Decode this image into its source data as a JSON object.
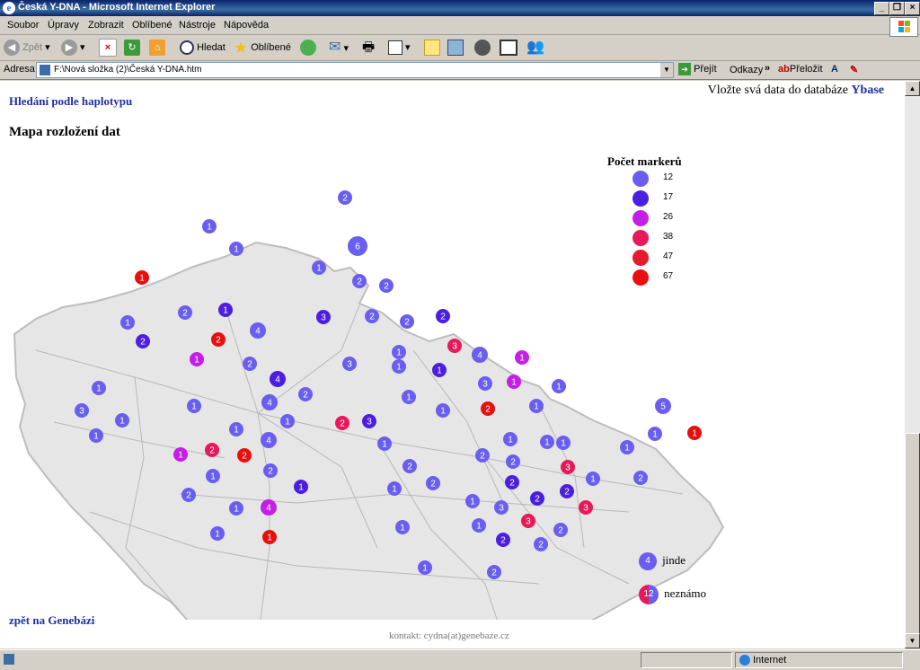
{
  "window": {
    "title": "Česká Y-DNA - Microsoft Internet Explorer"
  },
  "menu": [
    "Soubor",
    "Úpravy",
    "Zobrazit",
    "Oblíbené",
    "Nástroje",
    "Nápověda"
  ],
  "toolbar": {
    "back": "Zpět",
    "search": "Hledat",
    "favorites": "Oblíbené"
  },
  "address": {
    "label": "Adresa",
    "url": "F:\\Nová složka (2)\\Česká Y-DNA.htm",
    "go": "Přejít",
    "links": "Odkazy",
    "translate": "Přeložit"
  },
  "page": {
    "haplotype_link": "Hledání podle haplotypu",
    "insert_text": "Vložte svá data do databáze",
    "ybase_link": "Ybase",
    "map_title": "Mapa rozložení dat",
    "back_link": "zpět na Genebázi",
    "contact": "kontakt: cydna(at)genebaze.cz"
  },
  "legend": {
    "title": "Počet markerů",
    "items": [
      {
        "label": "12",
        "color": "#6a5ef0"
      },
      {
        "label": "17",
        "color": "#4b1fe0"
      },
      {
        "label": "26",
        "color": "#c41fe6"
      },
      {
        "label": "38",
        "color": "#e8195a"
      },
      {
        "label": "47",
        "color": "#e81a2e"
      },
      {
        "label": "67",
        "color": "#e80f0f"
      }
    ],
    "elsewhere": {
      "count": "4",
      "label": "jinde"
    },
    "unknown": {
      "count": "12",
      "label": "neznámo"
    }
  },
  "map_markers": [
    {
      "n": "2",
      "c": "#6a5ef0"
    },
    {
      "n": "1",
      "c": "#6a5ef0"
    },
    {
      "n": "6",
      "c": "#6a5ef0"
    },
    {
      "n": "1",
      "c": "#6a5ef0"
    },
    {
      "n": "1",
      "c": "#e80f0f"
    },
    {
      "n": "1",
      "c": "#6a5ef0"
    },
    {
      "n": "2",
      "c": "#6a5ef0"
    },
    {
      "n": "2",
      "c": "#6a5ef0"
    },
    {
      "n": "2",
      "c": "#6a5ef0"
    },
    {
      "n": "1",
      "c": "#4b1fe0"
    },
    {
      "n": "3",
      "c": "#4b1fe0"
    },
    {
      "n": "2",
      "c": "#6a5ef0"
    },
    {
      "n": "2",
      "c": "#6a5ef0"
    },
    {
      "n": "2",
      "c": "#4b1fe0"
    },
    {
      "n": "1",
      "c": "#6a5ef0"
    },
    {
      "n": "4",
      "c": "#6a5ef0"
    },
    {
      "n": "2",
      "c": "#4b1fe0"
    },
    {
      "n": "2",
      "c": "#e80f0f"
    },
    {
      "n": "3",
      "c": "#e8195a"
    },
    {
      "n": "4",
      "c": "#6a5ef0"
    },
    {
      "n": "1",
      "c": "#c41fe6"
    },
    {
      "n": "2",
      "c": "#6a5ef0"
    },
    {
      "n": "3",
      "c": "#6a5ef0"
    },
    {
      "n": "1",
      "c": "#6a5ef0"
    },
    {
      "n": "1",
      "c": "#6a5ef0"
    },
    {
      "n": "1",
      "c": "#4b1fe0"
    },
    {
      "n": "1",
      "c": "#c41fe6"
    },
    {
      "n": "1",
      "c": "#c41fe6"
    },
    {
      "n": "4",
      "c": "#4b1fe0"
    },
    {
      "n": "3",
      "c": "#6a5ef0"
    },
    {
      "n": "1",
      "c": "#6a5ef0"
    },
    {
      "n": "1",
      "c": "#6a5ef0"
    },
    {
      "n": "2",
      "c": "#6a5ef0"
    },
    {
      "n": "1",
      "c": "#6a5ef0"
    },
    {
      "n": "4",
      "c": "#6a5ef0"
    },
    {
      "n": "1",
      "c": "#6a5ef0"
    },
    {
      "n": "3",
      "c": "#6a5ef0"
    },
    {
      "n": "1",
      "c": "#6a5ef0"
    },
    {
      "n": "1",
      "c": "#6a5ef0"
    },
    {
      "n": "2",
      "c": "#e8195a"
    },
    {
      "n": "1",
      "c": "#6a5ef0"
    },
    {
      "n": "5",
      "c": "#6a5ef0"
    },
    {
      "n": "1",
      "c": "#6a5ef0"
    },
    {
      "n": "2",
      "c": "#e80f0f"
    },
    {
      "n": "3",
      "c": "#4b1fe0"
    },
    {
      "n": "1",
      "c": "#6a5ef0"
    },
    {
      "n": "1",
      "c": "#6a5ef0"
    },
    {
      "n": "4",
      "c": "#6a5ef0"
    },
    {
      "n": "1",
      "c": "#e80f0f"
    },
    {
      "n": "1",
      "c": "#6a5ef0"
    },
    {
      "n": "1",
      "c": "#c41fe6"
    },
    {
      "n": "2",
      "c": "#e8195a"
    },
    {
      "n": "2",
      "c": "#e80f0f"
    },
    {
      "n": "1",
      "c": "#6a5ef0"
    },
    {
      "n": "1",
      "c": "#6a5ef0"
    },
    {
      "n": "1",
      "c": "#6a5ef0"
    },
    {
      "n": "2",
      "c": "#6a5ef0"
    },
    {
      "n": "1",
      "c": "#6a5ef0"
    },
    {
      "n": "2",
      "c": "#6a5ef0"
    },
    {
      "n": "3",
      "c": "#e8195a"
    },
    {
      "n": "1",
      "c": "#6a5ef0"
    },
    {
      "n": "2",
      "c": "#6a5ef0"
    },
    {
      "n": "1",
      "c": "#6a5ef0"
    },
    {
      "n": "2",
      "c": "#6a5ef0"
    },
    {
      "n": "2",
      "c": "#6a5ef0"
    },
    {
      "n": "1",
      "c": "#4b1fe0"
    },
    {
      "n": "2",
      "c": "#4b1fe0"
    },
    {
      "n": "2",
      "c": "#6a5ef0"
    },
    {
      "n": "2",
      "c": "#4b1fe0"
    },
    {
      "n": "1",
      "c": "#6a5ef0"
    },
    {
      "n": "2",
      "c": "#6a5ef0"
    },
    {
      "n": "2",
      "c": "#4b1fe0"
    },
    {
      "n": "4",
      "c": "#c41fe6"
    },
    {
      "n": "1",
      "c": "#6a5ef0"
    },
    {
      "n": "3",
      "c": "#e8195a"
    },
    {
      "n": "1",
      "c": "#6a5ef0"
    },
    {
      "n": "1",
      "c": "#e80f0f"
    },
    {
      "n": "3",
      "c": "#e8195a"
    },
    {
      "n": "1",
      "c": "#6a5ef0"
    },
    {
      "n": "2",
      "c": "#6a5ef0"
    },
    {
      "n": "1",
      "c": "#6a5ef0"
    },
    {
      "n": "2",
      "c": "#4b1fe0"
    },
    {
      "n": "1",
      "c": "#6a5ef0"
    },
    {
      "n": "2",
      "c": "#6a5ef0"
    },
    {
      "n": "1",
      "c": "#6a5ef0"
    },
    {
      "n": "2",
      "c": "#6a5ef0"
    },
    {
      "n": "1",
      "c": "#6a5ef0"
    },
    {
      "n": "3",
      "c": "#6a5ef0"
    }
  ],
  "status": {
    "zone": "Internet"
  }
}
